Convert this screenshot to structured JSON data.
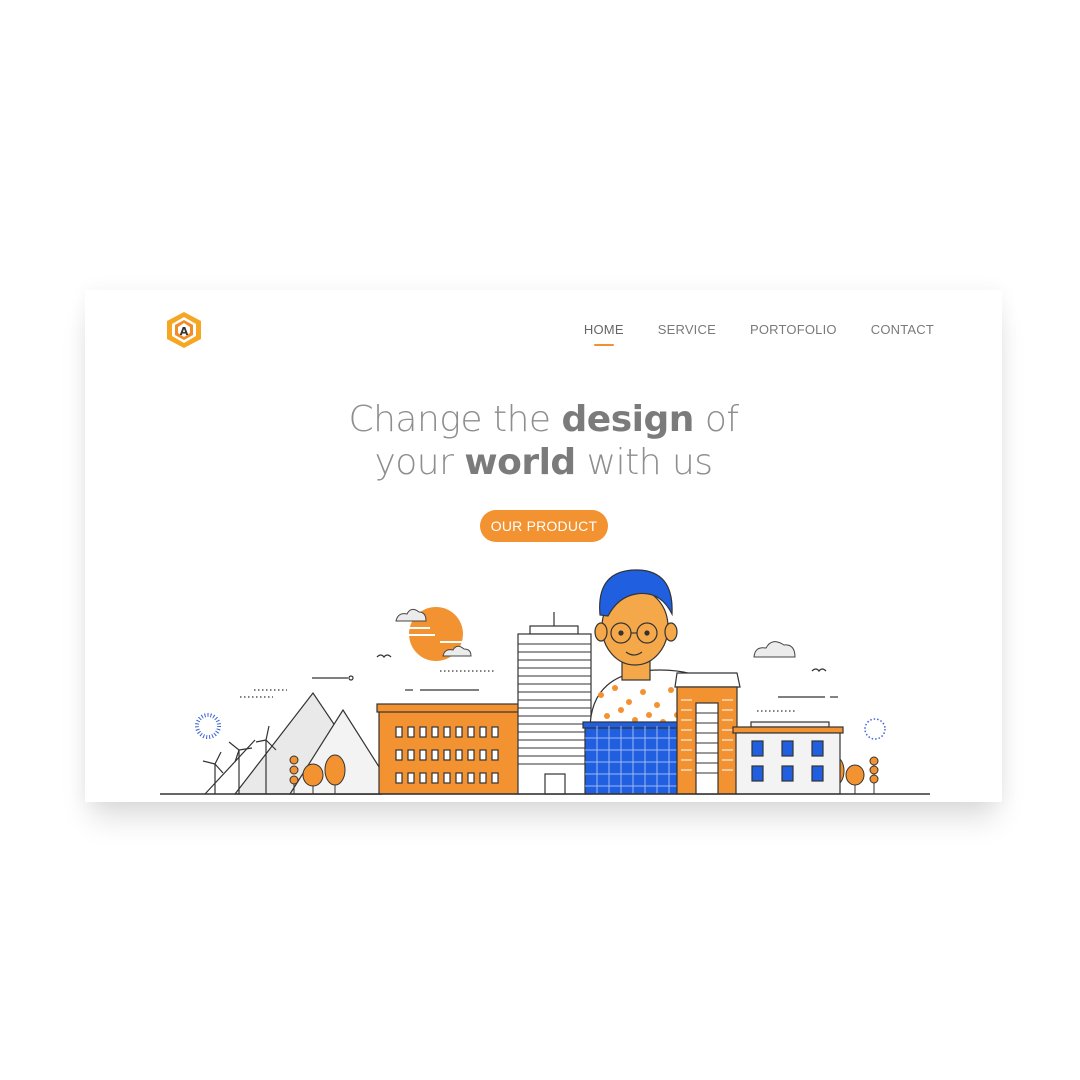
{
  "brand": {
    "logo_icon": "hexagon-a-logo",
    "accent": "#f39230",
    "blue": "#1f5fe0"
  },
  "nav": {
    "items": [
      {
        "label": "HOME",
        "active": true
      },
      {
        "label": "SERVICE",
        "active": false
      },
      {
        "label": "PORTOFOLIO",
        "active": false
      },
      {
        "label": "CONTACT",
        "active": false
      }
    ]
  },
  "hero": {
    "line1_pre": "Change the ",
    "line1_bold": "design",
    "line1_post": " of",
    "line2_pre": "your ",
    "line2_bold": "world",
    "line2_post": " with us",
    "cta_label": "OUR PRODUCT"
  },
  "illustration": {
    "name": "city-skyline-with-character"
  }
}
